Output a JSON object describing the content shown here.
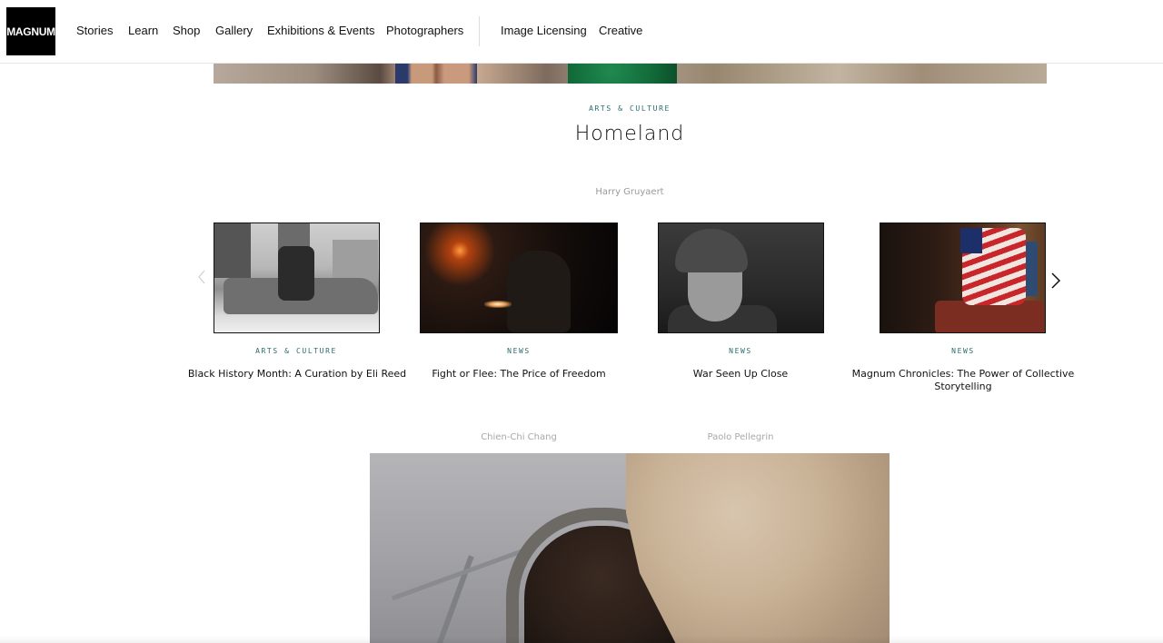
{
  "header": {
    "logo": "MAGNUM",
    "nav_primary": [
      "Stories",
      "Learn",
      "Shop",
      "Gallery",
      "Exhibitions & Events",
      "Photographers"
    ],
    "nav_secondary": [
      "Image Licensing",
      "Creative"
    ]
  },
  "feature": {
    "kicker": "ARTS & CULTURE",
    "title": "Homeland",
    "author": "Harry Gruyaert"
  },
  "carousel": {
    "items": [
      {
        "category": "ARTS & CULTURE",
        "title": "Black History Month: A Curation by Eli Reed",
        "image": "black-and-white-street-scene"
      },
      {
        "category": "NEWS",
        "title": "Fight or Flee: The Price of Freedom",
        "image": "night-gunfire"
      },
      {
        "category": "NEWS",
        "title": "War Seen Up Close",
        "image": "soldier-portrait"
      },
      {
        "category": "NEWS",
        "title": "Magnum Chronicles: The Power of Collective Storytelling",
        "image": "flag-in-room"
      }
    ],
    "prev_icon": "chevron-left-icon",
    "next_icon": "chevron-right-icon"
  },
  "bylines": {
    "left": "Chien-Chi Chang",
    "right": "Paolo Pellegrin"
  },
  "colors": {
    "accent": "#2a6b6e",
    "byline": "#9a9a9a",
    "logo_bg": "#000000"
  }
}
